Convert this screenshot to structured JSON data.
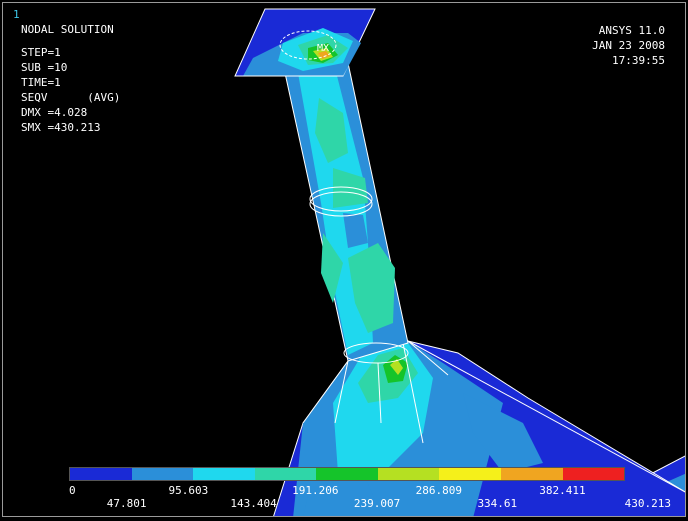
{
  "window_number": "1",
  "header": {
    "title": "NODAL SOLUTION",
    "step": "STEP=1",
    "sub": "SUB =10",
    "time": "TIME=1",
    "result": "SEQV      (AVG)",
    "dmx": "DMX =4.028",
    "smx": "SMX =430.213"
  },
  "header_right": {
    "product": "ANSYS 11.0",
    "date": "JAN 23 2008",
    "time": "17:39:55"
  },
  "model": {
    "max_marker": "MX"
  },
  "legend": {
    "colors": [
      "#1a2ad6",
      "#2b8fd9",
      "#1fd8ee",
      "#2fd6a8",
      "#15c42a",
      "#b5e022",
      "#f5f01a",
      "#f0a520",
      "#ee2020"
    ],
    "labels_top": [
      "0",
      "95.603",
      "191.206",
      "286.809",
      "382.411"
    ],
    "labels_bottom": [
      "47.801",
      "143.404",
      "239.007",
      "334.61",
      "430.213"
    ]
  }
}
